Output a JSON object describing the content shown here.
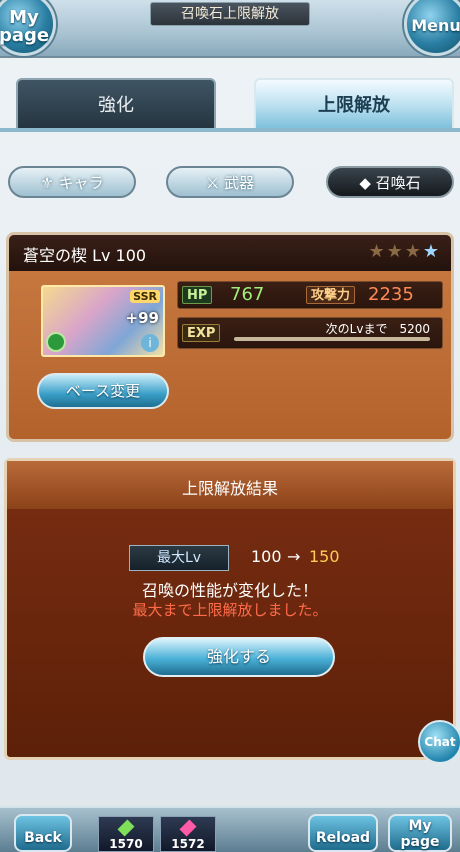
{
  "header": {
    "title": "召喚石上限解放",
    "mypage_line1": "My",
    "mypage_line2": "page",
    "menu": "Menu"
  },
  "tabs": [
    {
      "label": "強化"
    },
    {
      "label": "上限解放"
    }
  ],
  "categories": [
    {
      "label": "キャラ"
    },
    {
      "label": "武器"
    },
    {
      "label": "召喚石"
    }
  ],
  "summon": {
    "name": "蒼空の楔 Lv 100",
    "star_dim": "★★★",
    "star_lit": "★",
    "rarity": "SSR",
    "plus": "+99",
    "hp_label": "HP",
    "hp_value": "767",
    "atk_label": "攻撃力",
    "atk_value": "2235",
    "exp_label": "EXP",
    "next_label": "次のLvまで　5200",
    "base_change": "ベース変更",
    "info_icon": "i"
  },
  "result": {
    "title": "上限解放結果",
    "maxlv_label": "最大Lv",
    "lv_old": "100",
    "lv_arrow": "→",
    "lv_new": "150",
    "message1": "召喚の性能が変化した！",
    "message2": "最大まで上限解放しました。",
    "enhance_button": "強化する"
  },
  "chat": "Chat",
  "footer": {
    "back": "Back",
    "item1_count": "1570",
    "item2_count": "1572",
    "reload": "Reload",
    "mypage_line1": "My",
    "mypage_line2": "page"
  },
  "colors": {
    "accent": "#3a9ec7",
    "panel": "#b4622c",
    "result_panel": "#5d2009",
    "warning": "#ff6b4a",
    "new_level": "#ffcc55"
  }
}
